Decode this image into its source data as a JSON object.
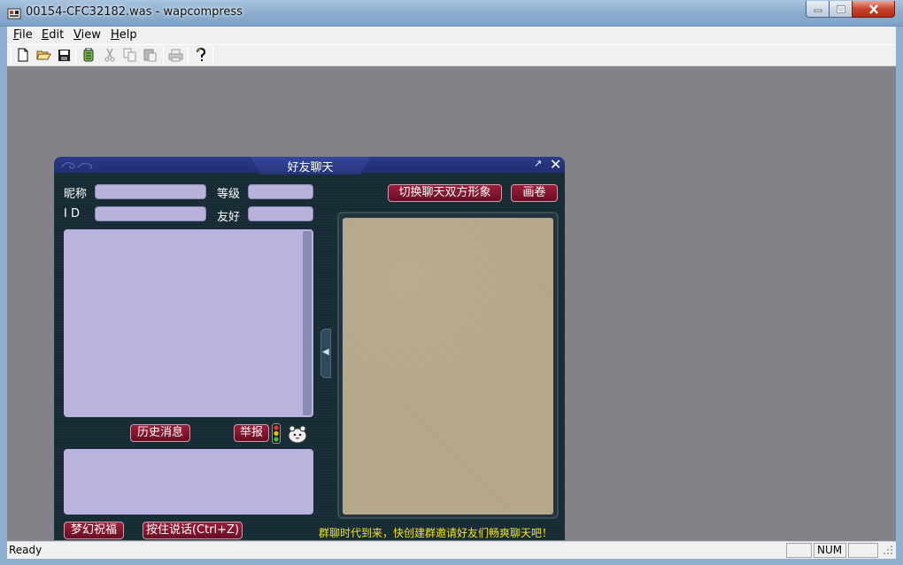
{
  "window": {
    "title": "00154-CFC32182.was - wapcompress"
  },
  "menu": {
    "items": [
      {
        "label": "File",
        "key": "F",
        "rest": "ile"
      },
      {
        "label": "Edit",
        "key": "E",
        "rest": "dit"
      },
      {
        "label": "View",
        "key": "V",
        "rest": "iew"
      },
      {
        "label": "Help",
        "key": "H",
        "rest": "elp"
      }
    ]
  },
  "toolbar": {
    "icons": [
      "new-file-icon",
      "open-folder-icon",
      "save-icon",
      "compress-icon",
      "cut-icon",
      "copy-icon",
      "paste-icon",
      "print-icon",
      "help-icon"
    ]
  },
  "status": {
    "text": "Ready",
    "num": "NUM"
  },
  "dialog": {
    "title": "好友聊天",
    "nickname_label": "昵称",
    "level_label": "等级",
    "id_label": "I D",
    "friendship_label": "友好",
    "switch_button": "切换聊天双方形象",
    "scroll_button": "画卷",
    "history_button": "历史消息",
    "report_button": "举报",
    "wish_button": "梦幻祝福",
    "talk_button": "按住说话(Ctrl+Z)",
    "notice": "群聊时代到来，快创建群邀请好友们畅爽聊天吧！"
  },
  "colors": {
    "titlebar": "#8eafd0",
    "workspace": "#848289",
    "dialog_bg": "#172b35",
    "field": "#b9b2db",
    "button_red": "#7d1530",
    "notice_yellow": "#f2e41a",
    "portrait": "#b6a88b"
  }
}
